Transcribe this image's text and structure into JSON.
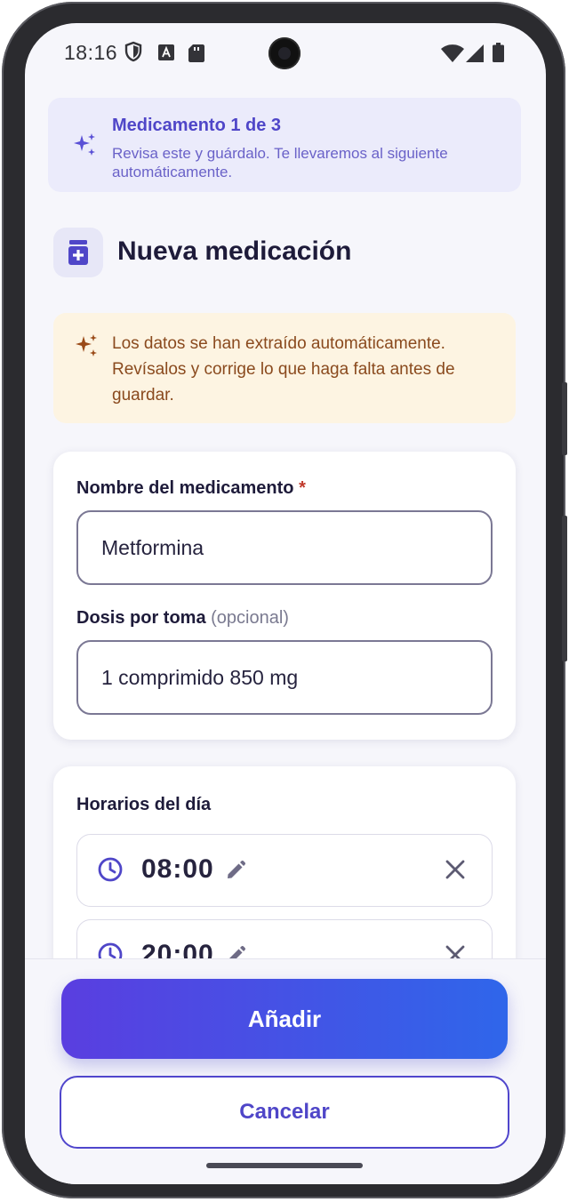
{
  "status_bar": {
    "time": "18:16",
    "icons": [
      "shield-icon",
      "font-icon",
      "sd-card-icon",
      "wifi-icon",
      "signal-icon",
      "battery-icon"
    ]
  },
  "banner": {
    "title": "Medicamento 1 de 3",
    "subtitle": "Revisa este y guárdalo. Te llevaremos al siguiente automáticamente.",
    "icon": "sparkles-icon"
  },
  "header": {
    "title": "Nueva medicación",
    "icon": "medication-icon"
  },
  "ai_notice": {
    "text": "Los datos se han extraído automáticamente. Revísalos y corrige lo que haga falta antes de guardar.",
    "icon": "sparkles-icon"
  },
  "form": {
    "name": {
      "label": "Nombre del medicamento",
      "required_mark": "*",
      "value": "Metformina"
    },
    "dose": {
      "label": "Dosis por toma",
      "optional_text": "(opcional)",
      "value": "1 comprimido 850 mg"
    }
  },
  "schedule": {
    "label": "Horarios del día",
    "items": [
      {
        "time": "08:00"
      },
      {
        "time": "20:00"
      }
    ]
  },
  "actions": {
    "add_label": "Añadir",
    "cancel_label": "Cancelar"
  },
  "colors": {
    "accent": "#4f46c8",
    "gradient_start": "#5a3ee0",
    "gradient_end": "#2f66ea",
    "banner_bg": "#ebebfb",
    "notice_bg": "#fdf4e2",
    "notice_text": "#8a4a1e"
  }
}
